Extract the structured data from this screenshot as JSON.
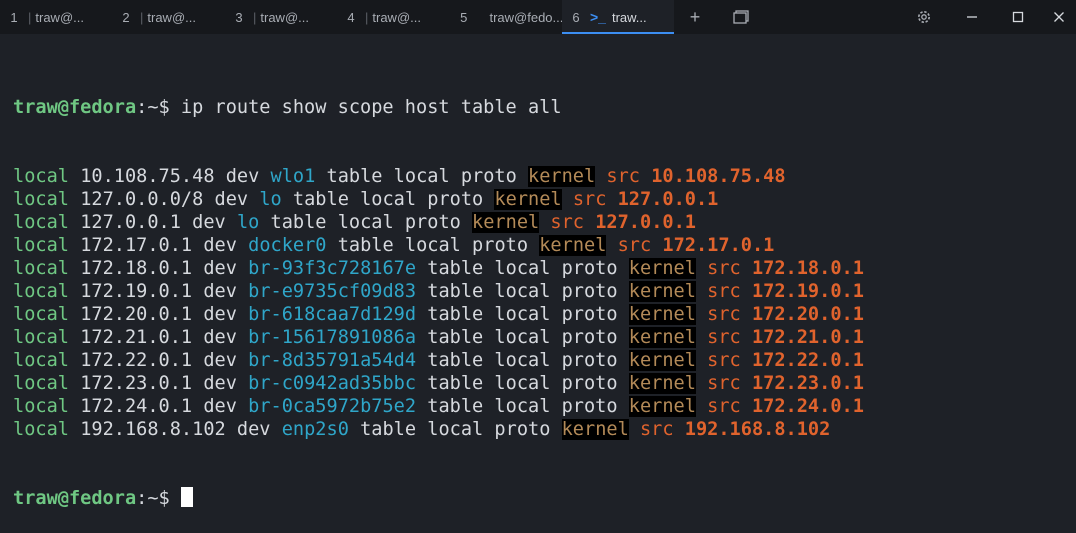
{
  "tabs": [
    {
      "num": "1",
      "title": "traw@..."
    },
    {
      "num": "2",
      "title": "traw@..."
    },
    {
      "num": "3",
      "title": "traw@..."
    },
    {
      "num": "4",
      "title": "traw@..."
    },
    {
      "num": "5",
      "title": "traw@fedo..."
    },
    {
      "num": "6",
      "title": "traw..."
    }
  ],
  "toolbar_icons": [
    "plus-icon",
    "tabs-overview-icon",
    "gear-icon",
    "minimize-icon",
    "maximize-icon",
    "close-icon"
  ],
  "prompt": {
    "user": "traw@fedora",
    "path": ":~$ ",
    "command": "ip route show scope host table all"
  },
  "routes": [
    {
      "dest": "10.108.75.48",
      "dev": "wlo1",
      "src": "10.108.75.48"
    },
    {
      "dest": "127.0.0.0/8",
      "dev": "lo",
      "src": "127.0.0.1"
    },
    {
      "dest": "127.0.0.1",
      "dev": "lo",
      "src": "127.0.0.1"
    },
    {
      "dest": "172.17.0.1",
      "dev": "docker0",
      "src": "172.17.0.1"
    },
    {
      "dest": "172.18.0.1",
      "dev": "br-93f3c728167e",
      "src": "172.18.0.1"
    },
    {
      "dest": "172.19.0.1",
      "dev": "br-e9735cf09d83",
      "src": "172.19.0.1"
    },
    {
      "dest": "172.20.0.1",
      "dev": "br-618caa7d129d",
      "src": "172.20.0.1"
    },
    {
      "dest": "172.21.0.1",
      "dev": "br-15617891086a",
      "src": "172.21.0.1"
    },
    {
      "dest": "172.22.0.1",
      "dev": "br-8d35791a54d4",
      "src": "172.22.0.1"
    },
    {
      "dest": "172.23.0.1",
      "dev": "br-c0942ad35bbc",
      "src": "172.23.0.1"
    },
    {
      "dest": "172.24.0.1",
      "dev": "br-0ca5972b75e2",
      "src": "172.24.0.1"
    },
    {
      "dest": "192.168.8.102",
      "dev": "enp2s0",
      "src": "192.168.8.102"
    }
  ],
  "words": {
    "local": "local",
    "dev": "dev",
    "table_local_proto": "table local proto",
    "kernel": "kernel",
    "src": "src"
  },
  "colors": {
    "background": "#1e2127",
    "prompt_green": "#6fc783",
    "device_cyan": "#2fa6c9",
    "src_orange": "#e0632d",
    "kernel": "#b38a58",
    "accent": "#3c8ef2"
  }
}
